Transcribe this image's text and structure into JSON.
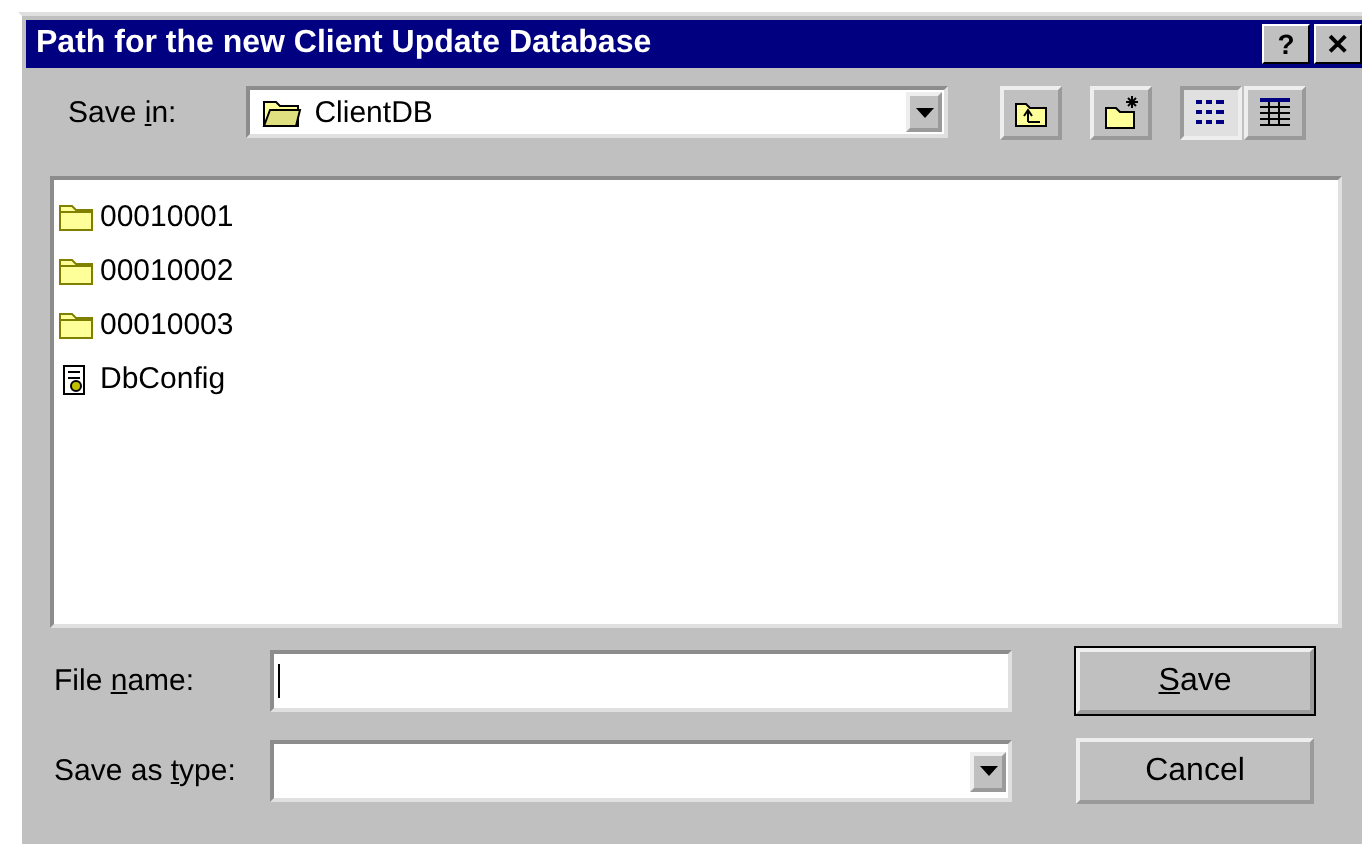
{
  "window": {
    "title": "Path for the new Client Update Database",
    "title_buttons": [
      "?",
      "✕"
    ]
  },
  "save_in": {
    "label": {
      "before": "Save ",
      "key": "i",
      "after": "n:"
    },
    "value": "ClientDB"
  },
  "toolbar": [
    {
      "kind": "up"
    },
    {
      "kind": "new-folder"
    },
    {
      "kind": "list",
      "selected": true
    },
    {
      "kind": "details",
      "selected": false
    }
  ],
  "files": [
    {
      "kind": "folder",
      "name": "00010001"
    },
    {
      "kind": "folder",
      "name": "00010002"
    },
    {
      "kind": "folder",
      "name": "00010003"
    },
    {
      "kind": "config",
      "name": "DbConfig"
    }
  ],
  "file_name": {
    "label": {
      "before": "File ",
      "key": "n",
      "after": "ame:"
    }
  },
  "save_as_type": {
    "label": {
      "before": "Save as ",
      "key": "t",
      "after": "ype:"
    }
  },
  "buttons": [
    {
      "label": {
        "key": "S",
        "after": "ave"
      },
      "default": true
    },
    {
      "label": {
        "before": "Cancel"
      },
      "default": false
    }
  ]
}
